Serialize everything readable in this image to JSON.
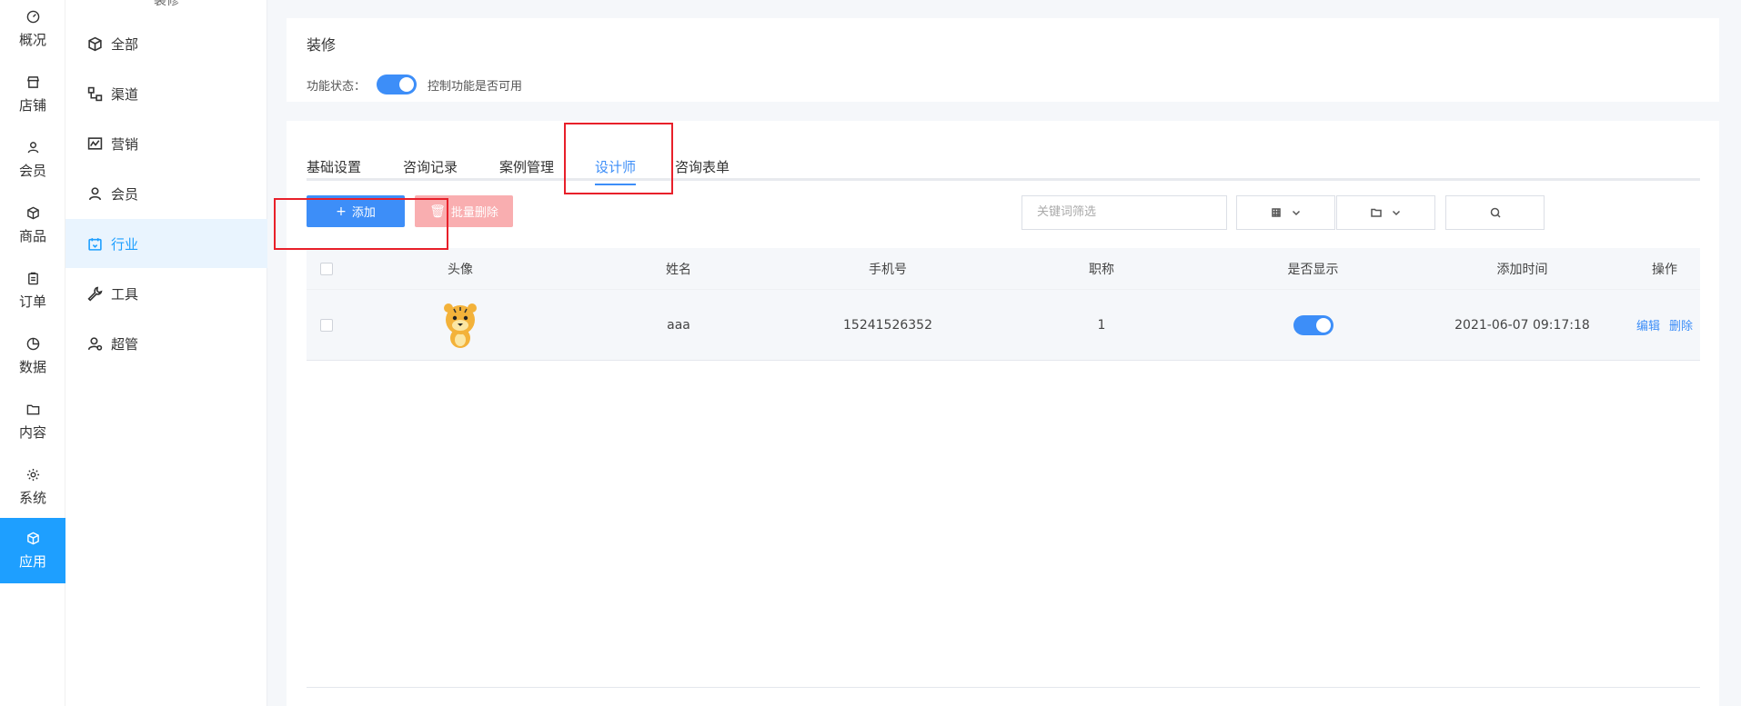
{
  "rail": {
    "items": [
      {
        "label": "概况",
        "icon": "dashboard-icon"
      },
      {
        "label": "店铺",
        "icon": "store-icon"
      },
      {
        "label": "会员",
        "icon": "user-icon"
      },
      {
        "label": "商品",
        "icon": "cube-icon"
      },
      {
        "label": "订单",
        "icon": "clipboard-icon"
      },
      {
        "label": "数据",
        "icon": "pie-icon"
      },
      {
        "label": "内容",
        "icon": "folder-icon"
      },
      {
        "label": "系统",
        "icon": "gear-icon"
      },
      {
        "label": "应用",
        "icon": "box-icon"
      }
    ],
    "active_index": 8
  },
  "submenu": {
    "top_label": "装修",
    "items": [
      {
        "label": "全部",
        "icon": "cube-icon"
      },
      {
        "label": "渠道",
        "icon": "channel-icon"
      },
      {
        "label": "营销",
        "icon": "chart-icon"
      },
      {
        "label": "会员",
        "icon": "user-icon"
      },
      {
        "label": "行业",
        "icon": "industry-icon"
      },
      {
        "label": "工具",
        "icon": "wrench-icon"
      },
      {
        "label": "超管",
        "icon": "admin-icon"
      }
    ],
    "active_index": 4
  },
  "feature": {
    "title": "装修",
    "status_label": "功能状态：",
    "status_on": true,
    "status_hint": "控制功能是否可用"
  },
  "tabs": [
    {
      "label": "基础设置",
      "active": false
    },
    {
      "label": "咨询记录",
      "active": false
    },
    {
      "label": "案例管理",
      "active": false
    },
    {
      "label": "设计师",
      "active": true
    },
    {
      "label": "咨询表单",
      "active": false
    }
  ],
  "toolbar": {
    "add_label": "添加",
    "batch_delete_label": "批量删除",
    "search_placeholder": "关键词筛选"
  },
  "table": {
    "headers": [
      "头像",
      "姓名",
      "手机号",
      "职称",
      "是否显示",
      "添加时间",
      "操作"
    ],
    "rows": [
      {
        "name": "aaa",
        "phone": "15241526352",
        "title": "1",
        "show": true,
        "time": "2021-06-07 09:17:18",
        "edit": "编辑",
        "delete": "删除"
      }
    ]
  },
  "colors": {
    "accent": "#3d8ef8",
    "sidebar_active": "#1e9fff",
    "danger_light": "#f9aeb0",
    "annotation": "#e8202a"
  }
}
